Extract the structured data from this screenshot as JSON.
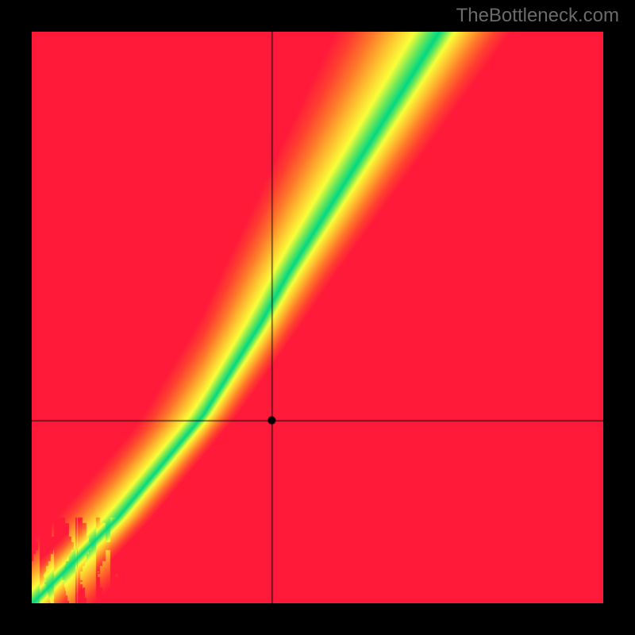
{
  "watermark": "TheBottleneck.com",
  "chart_data": {
    "type": "heatmap",
    "title": "",
    "xlabel": "",
    "ylabel": "",
    "xlim": [
      0,
      1
    ],
    "ylim": [
      0,
      1
    ],
    "crosshair": {
      "x": 0.42,
      "y": 0.68
    },
    "ridge_curve_description": "green optimal band curving from lower-left to upper-right, steeper in upper half",
    "ridge_samples_plot_coords": [
      {
        "x": 0.0,
        "y": 1.0
      },
      {
        "x": 0.05,
        "y": 0.95
      },
      {
        "x": 0.1,
        "y": 0.9
      },
      {
        "x": 0.15,
        "y": 0.85
      },
      {
        "x": 0.2,
        "y": 0.79
      },
      {
        "x": 0.25,
        "y": 0.73
      },
      {
        "x": 0.3,
        "y": 0.67
      },
      {
        "x": 0.35,
        "y": 0.59
      },
      {
        "x": 0.4,
        "y": 0.51
      },
      {
        "x": 0.45,
        "y": 0.42
      },
      {
        "x": 0.5,
        "y": 0.34
      },
      {
        "x": 0.55,
        "y": 0.26
      },
      {
        "x": 0.6,
        "y": 0.18
      },
      {
        "x": 0.65,
        "y": 0.1
      },
      {
        "x": 0.7,
        "y": 0.02
      }
    ],
    "color_stops": [
      {
        "t": 0.0,
        "color": "#00d884"
      },
      {
        "t": 0.1,
        "color": "#6de85a"
      },
      {
        "t": 0.22,
        "color": "#f9ff3a"
      },
      {
        "t": 0.4,
        "color": "#ffc030"
      },
      {
        "t": 0.6,
        "color": "#ff7a2a"
      },
      {
        "t": 0.8,
        "color": "#ff4030"
      },
      {
        "t": 1.0,
        "color": "#ff1a3a"
      }
    ],
    "grid": false,
    "legend": false
  }
}
